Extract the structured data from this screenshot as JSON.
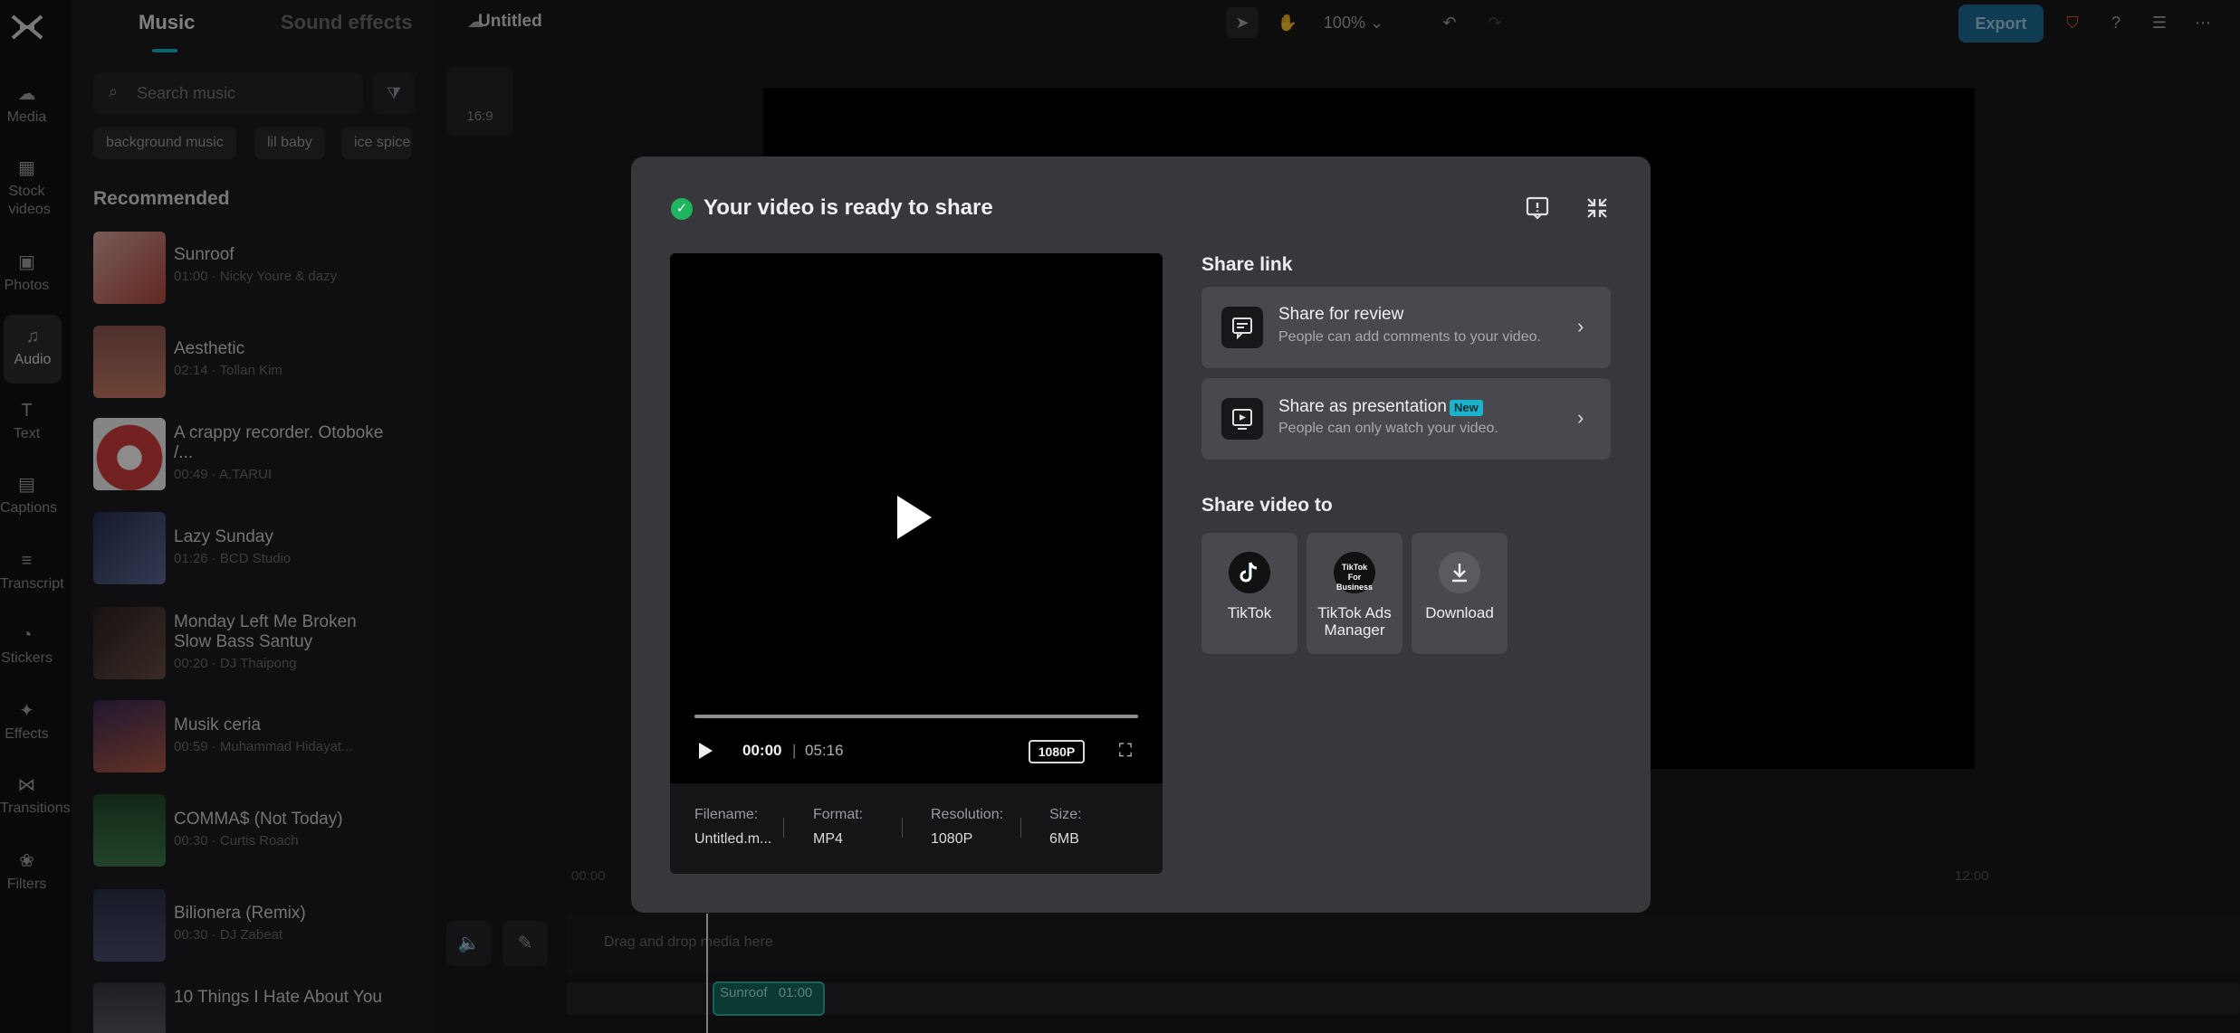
{
  "rail": {
    "items": [
      {
        "label": "Media",
        "icon": "cloud-icon"
      },
      {
        "label": "Stock videos",
        "icon": "film-icon"
      },
      {
        "label": "Photos",
        "icon": "image-icon"
      },
      {
        "label": "Audio",
        "icon": "music-icon"
      },
      {
        "label": "Text",
        "icon": "text-icon"
      },
      {
        "label": "Captions",
        "icon": "captions-icon"
      },
      {
        "label": "Transcript",
        "icon": "transcript-icon"
      },
      {
        "label": "Stickers",
        "icon": "sticker-icon"
      },
      {
        "label": "Effects",
        "icon": "effects-icon"
      },
      {
        "label": "Transitions",
        "icon": "transitions-icon"
      },
      {
        "label": "Filters",
        "icon": "filters-icon"
      }
    ]
  },
  "panel": {
    "tab_music": "Music",
    "tab_sfx": "Sound effects",
    "search_placeholder": "Search music",
    "chips": [
      "background music",
      "lil baby",
      "ice spice"
    ],
    "section_title": "Recommended",
    "songs": [
      {
        "title": "Sunroof",
        "meta": "01:00 · Nicky Youre & dazy",
        "color": "#b34a3c"
      },
      {
        "title": "Aesthetic",
        "meta": "02:14 · Tollan Kim",
        "color": "#a56a5c"
      },
      {
        "title": "A crappy recorder. Otoboke /...",
        "meta": "00:49 · A.TARUI",
        "color": "#d23b3b"
      },
      {
        "title": "Lazy Sunday",
        "meta": "01:26 · BCD Studio",
        "color": "#3b4566"
      },
      {
        "title": "Monday Left Me Broken Slow Bass Santuy",
        "meta": "00:20 · DJ Thaipong",
        "color": "#4a3a34"
      },
      {
        "title": "Musik ceria",
        "meta": "00:59 · Muhammad Hidayat...",
        "color": "#5c4a6e"
      },
      {
        "title": "COMMA$ (Not Today)",
        "meta": "00:30 · Curtis Roach",
        "color": "#2c5e3a"
      },
      {
        "title": "Bilionera (Remix)",
        "meta": "00:30 · DJ Zabeat",
        "color": "#3a3d57"
      },
      {
        "title": "10 Things I Hate About You",
        "meta": "",
        "color": "#4a4650"
      }
    ]
  },
  "topbar": {
    "title": "Untitled",
    "zoom": "100%",
    "export": "Export"
  },
  "editor": {
    "ratio": "16:9",
    "drag_hint": "Drag and drop media here",
    "ruler": [
      "00:00",
      "12:00"
    ],
    "clip_name": "Sunroof",
    "clip_time": "01:00"
  },
  "modal": {
    "title": "Your video is ready to share",
    "player": {
      "current": "00:00",
      "separator": "|",
      "total": "05:16",
      "resolution_badge": "1080P"
    },
    "meta": [
      {
        "label": "Filename:",
        "value": "Untitled.m..."
      },
      {
        "label": "Format:",
        "value": "MP4"
      },
      {
        "label": "Resolution:",
        "value": "1080P"
      },
      {
        "label": "Size:",
        "value": "6MB"
      }
    ],
    "share_link_title": "Share link",
    "share_review": {
      "title": "Share for review",
      "sub": "People can add comments to your video."
    },
    "share_presentation": {
      "title": "Share as presentation",
      "badge": "New",
      "sub": "People can only watch your video."
    },
    "share_video_title": "Share video to",
    "targets": [
      {
        "label": "TikTok",
        "icon": "tiktok-icon"
      },
      {
        "label": "TikTok Ads Manager",
        "icon": "tiktok-ads-icon",
        "icon_text": "TikTok For Business"
      },
      {
        "label": "Download",
        "icon": "download-icon"
      }
    ]
  },
  "colors": {
    "accent": "#18b5c8",
    "export_button": "#1c6e96",
    "success": "#1fb55f",
    "new_badge": "#1ab3cc"
  }
}
